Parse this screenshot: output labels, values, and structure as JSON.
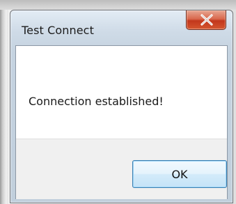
{
  "dialog": {
    "title": "Test Connect",
    "message": "Connection established!",
    "ok_label": "OK",
    "close_glyph": "X"
  },
  "colors": {
    "close_button": "#c7432a",
    "ok_button_border": "#3c7fb1",
    "client_background": "#ffffff",
    "footer_background": "#f0f0f0"
  },
  "icons": {
    "close": "close-icon"
  }
}
